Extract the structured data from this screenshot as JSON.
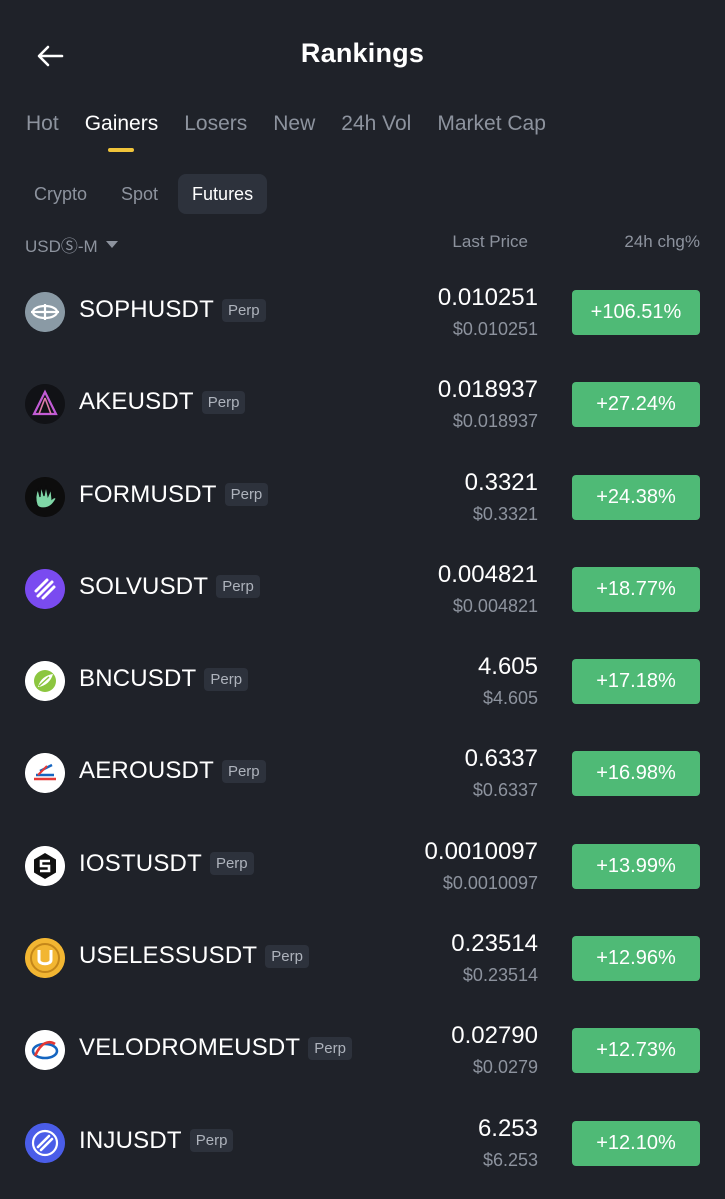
{
  "header": {
    "title": "Rankings",
    "back_icon": "arrow-left-icon"
  },
  "main_tabs": [
    {
      "label": "Hot",
      "active": false
    },
    {
      "label": "Gainers",
      "active": true
    },
    {
      "label": "Losers",
      "active": false
    },
    {
      "label": "New",
      "active": false
    },
    {
      "label": "24h Vol",
      "active": false
    },
    {
      "label": "Market Cap",
      "active": false
    }
  ],
  "sub_tabs": [
    {
      "label": "Crypto",
      "active": false
    },
    {
      "label": "Spot",
      "active": false
    },
    {
      "label": "Futures",
      "active": true
    }
  ],
  "columns": {
    "currency": "USDⓈ-M",
    "last_price": "Last Price",
    "change": "24h chg%"
  },
  "colors": {
    "background": "#1f2229",
    "accent": "#f0c43a",
    "gain": "#4fba76",
    "muted": "#8d939e"
  },
  "rows": [
    {
      "symbol": "SOPHUSDT",
      "tag": "Perp",
      "price": "0.010251",
      "price_usd": "$0.010251",
      "change": "+106.51%",
      "icon": "soph-icon"
    },
    {
      "symbol": "AKEUSDT",
      "tag": "Perp",
      "price": "0.018937",
      "price_usd": "$0.018937",
      "change": "+27.24%",
      "icon": "ake-icon"
    },
    {
      "symbol": "FORMUSDT",
      "tag": "Perp",
      "price": "0.3321",
      "price_usd": "$0.3321",
      "change": "+24.38%",
      "icon": "form-icon"
    },
    {
      "symbol": "SOLVUSDT",
      "tag": "Perp",
      "price": "0.004821",
      "price_usd": "$0.004821",
      "change": "+18.77%",
      "icon": "solv-icon"
    },
    {
      "symbol": "BNCUSDT",
      "tag": "Perp",
      "price": "4.605",
      "price_usd": "$4.605",
      "change": "+17.18%",
      "icon": "bnc-icon"
    },
    {
      "symbol": "AEROUSDT",
      "tag": "Perp",
      "price": "0.6337",
      "price_usd": "$0.6337",
      "change": "+16.98%",
      "icon": "aero-icon"
    },
    {
      "symbol": "IOSTUSDT",
      "tag": "Perp",
      "price": "0.0010097",
      "price_usd": "$0.0010097",
      "change": "+13.99%",
      "icon": "iost-icon"
    },
    {
      "symbol": "USELESSUSDT",
      "tag": "Perp",
      "price": "0.23514",
      "price_usd": "$0.23514",
      "change": "+12.96%",
      "icon": "useless-icon"
    },
    {
      "symbol": "VELODROMEUSDT",
      "tag": "Perp",
      "price": "0.02790",
      "price_usd": "$0.0279",
      "change": "+12.73%",
      "icon": "velodrome-icon"
    },
    {
      "symbol": "INJUSDT",
      "tag": "Perp",
      "price": "6.253",
      "price_usd": "$6.253",
      "change": "+12.10%",
      "icon": "inj-icon"
    }
  ]
}
